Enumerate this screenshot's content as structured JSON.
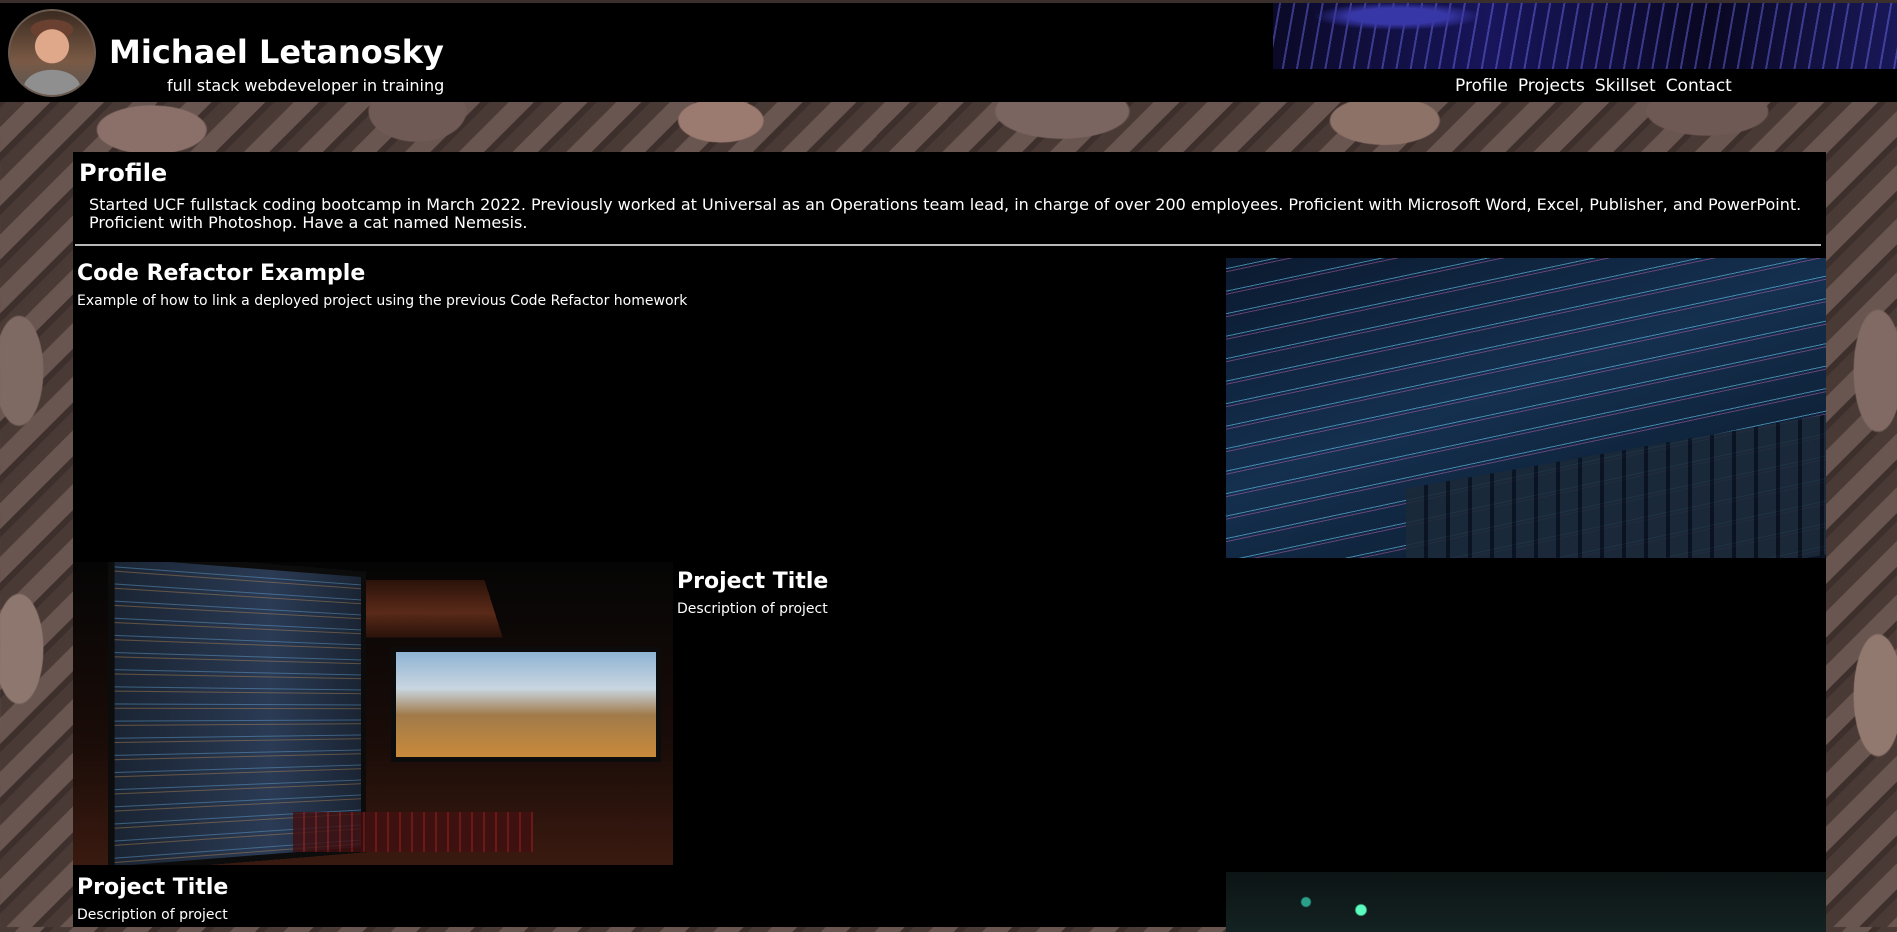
{
  "header": {
    "name": "Michael Letanosky",
    "tagline": "full stack webdeveloper in training",
    "nav": [
      "Profile",
      "Projects",
      "Skillset",
      "Contact"
    ]
  },
  "profile": {
    "heading": "Profile",
    "text": "Started UCF fullstack coding bootcamp in March 2022. Previously worked at Universal as an Operations team lead, in charge of over 200 employees. Proficient with Microsoft Word, Excel, Publisher, and PowerPoint. Proficient with Photoshop. Have a cat named Nemesis."
  },
  "projects": [
    {
      "title": "Code Refactor Example",
      "description": "Example of how to link a deployed project using the previous Code Refactor homework"
    },
    {
      "title": "Project Title",
      "description": "Description of project"
    },
    {
      "title": "Project Title",
      "description": "Description of project"
    }
  ]
}
